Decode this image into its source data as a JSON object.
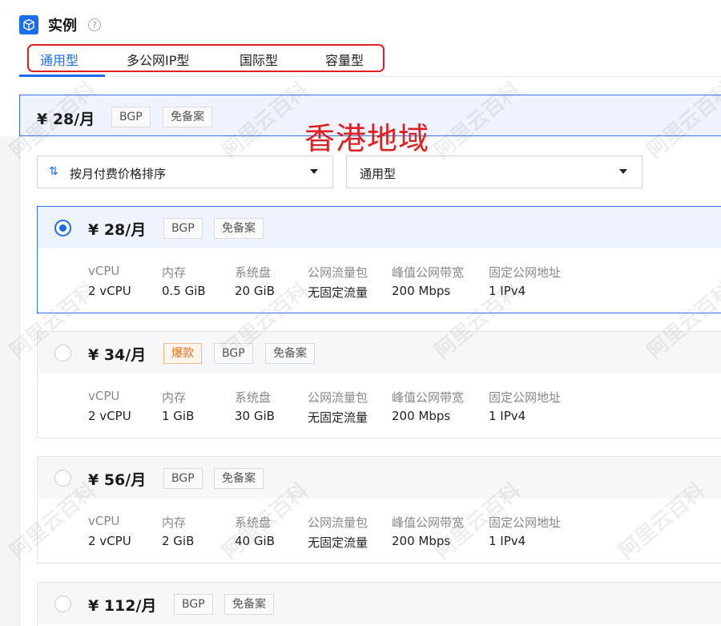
{
  "header": {
    "title": "实例",
    "help": "?"
  },
  "tabs": [
    {
      "label": "通用型",
      "active": true
    },
    {
      "label": "多公网IP型",
      "active": false
    },
    {
      "label": "国际型",
      "active": false
    },
    {
      "label": "容量型",
      "active": false
    }
  ],
  "summary": {
    "price": "¥ 28/月",
    "tags": [
      "BGP",
      "免备案"
    ]
  },
  "region_annotation": "香港地域",
  "filters": {
    "sort": {
      "label": "按月付费价格排序"
    },
    "type": {
      "label": "通用型"
    }
  },
  "spec_headers": [
    "vCPU",
    "内存",
    "系统盘",
    "公网流量包",
    "峰值公网带宽",
    "固定公网地址"
  ],
  "plans": [
    {
      "price": "¥ 28/月",
      "selected": true,
      "tags": [
        {
          "text": "BGP",
          "hot": false
        },
        {
          "text": "免备案",
          "hot": false
        }
      ],
      "specs": [
        "2 vCPU",
        "0.5 GiB",
        "20 GiB",
        "无固定流量",
        "200 Mbps",
        "1 IPv4"
      ]
    },
    {
      "price": "¥ 34/月",
      "selected": false,
      "tags": [
        {
          "text": "爆款",
          "hot": true
        },
        {
          "text": "BGP",
          "hot": false
        },
        {
          "text": "免备案",
          "hot": false
        }
      ],
      "specs": [
        "2 vCPU",
        "1 GiB",
        "30 GiB",
        "无固定流量",
        "200 Mbps",
        "1 IPv4"
      ]
    },
    {
      "price": "¥ 56/月",
      "selected": false,
      "tags": [
        {
          "text": "BGP",
          "hot": false
        },
        {
          "text": "免备案",
          "hot": false
        }
      ],
      "specs": [
        "2 vCPU",
        "2 GiB",
        "40 GiB",
        "无固定流量",
        "200 Mbps",
        "1 IPv4"
      ]
    },
    {
      "price": "¥ 112/月",
      "selected": false,
      "tags": [
        {
          "text": "BGP",
          "hot": false
        },
        {
          "text": "免备案",
          "hot": false
        }
      ],
      "specs": []
    }
  ],
  "watermark": "阿里云百科",
  "colors": {
    "primary": "#1a6cf0",
    "annotation": "#e02020",
    "hot": "#ef6c1a"
  }
}
